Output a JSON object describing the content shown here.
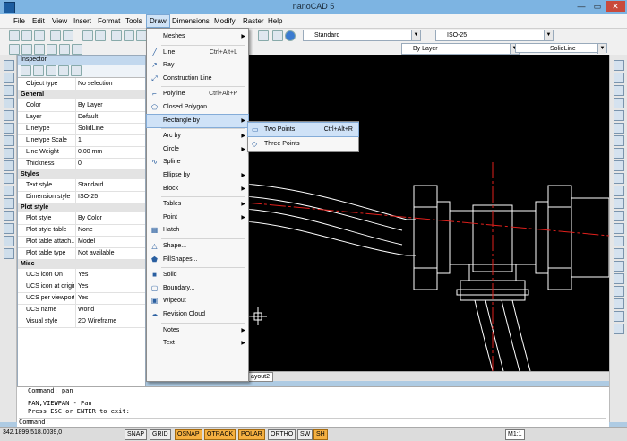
{
  "window": {
    "title": "nanoCAD 5"
  },
  "menubar": [
    "File",
    "Edit",
    "View",
    "Insert",
    "Format",
    "Tools",
    "Draw",
    "Dimensions",
    "Modify",
    "Raster",
    "Help"
  ],
  "toolbar": {
    "text_style": "Standard",
    "dim_style": "ISO-25",
    "layer": "By Layer",
    "linetype": "SolidLine"
  },
  "inspector": {
    "title": "Inspector",
    "object_type": {
      "name": "Object type",
      "value": "No selection"
    },
    "sections": [
      {
        "title": "General",
        "rows": [
          {
            "name": "Color",
            "value": "By Layer"
          },
          {
            "name": "Layer",
            "value": "Default"
          },
          {
            "name": "Linetype",
            "value": "SolidLine"
          },
          {
            "name": "Linetype Scale",
            "value": "1"
          },
          {
            "name": "Line Weight",
            "value": "0.00 mm"
          },
          {
            "name": "Thickness",
            "value": "0"
          }
        ]
      },
      {
        "title": "Styles",
        "rows": [
          {
            "name": "Text style",
            "value": "Standard"
          },
          {
            "name": "Dimension style",
            "value": "ISO-25"
          }
        ]
      },
      {
        "title": "Plot style",
        "rows": [
          {
            "name": "Plot style",
            "value": "By Color"
          },
          {
            "name": "Plot style table",
            "value": "None"
          },
          {
            "name": "Plot table attach...",
            "value": "Model"
          },
          {
            "name": "Plot table type",
            "value": "Not available"
          }
        ]
      },
      {
        "title": "Misc",
        "rows": [
          {
            "name": "UCS icon On",
            "value": "Yes"
          },
          {
            "name": "UCS icon at origin",
            "value": "Yes"
          },
          {
            "name": "UCS per viewport",
            "value": "Yes"
          },
          {
            "name": "UCS name",
            "value": "World"
          },
          {
            "name": "Visual style",
            "value": "2D Wireframe"
          }
        ]
      }
    ]
  },
  "draw_menu": {
    "items": [
      {
        "label": "Meshes",
        "shortcut": "",
        "submenu": true,
        "icon": ""
      },
      {
        "sep": true
      },
      {
        "label": "Line",
        "shortcut": "Ctrl+Alt+L",
        "submenu": false,
        "icon": "line-icon"
      },
      {
        "label": "Ray",
        "shortcut": "",
        "submenu": false,
        "icon": "ray-icon"
      },
      {
        "label": "Construction Line",
        "shortcut": "",
        "submenu": false,
        "icon": "construction-line-icon"
      },
      {
        "sep": true
      },
      {
        "label": "Polyline",
        "shortcut": "Ctrl+Alt+P",
        "submenu": false,
        "icon": "polyline-icon"
      },
      {
        "label": "Closed Polygon",
        "shortcut": "",
        "submenu": false,
        "icon": "polygon-icon"
      },
      {
        "label": "Rectangle by",
        "shortcut": "",
        "submenu": true,
        "icon": "",
        "highlighted": true
      },
      {
        "sep": true
      },
      {
        "label": "Arc by",
        "shortcut": "",
        "submenu": true,
        "icon": ""
      },
      {
        "label": "Circle",
        "shortcut": "",
        "submenu": true,
        "icon": ""
      },
      {
        "label": "Spline",
        "shortcut": "",
        "submenu": false,
        "icon": "spline-icon"
      },
      {
        "label": "Ellipse by",
        "shortcut": "",
        "submenu": true,
        "icon": ""
      },
      {
        "label": "Block",
        "shortcut": "",
        "submenu": true,
        "icon": ""
      },
      {
        "sep": true
      },
      {
        "label": "Tables",
        "shortcut": "",
        "submenu": true,
        "icon": ""
      },
      {
        "label": "Point",
        "shortcut": "",
        "submenu": true,
        "icon": ""
      },
      {
        "label": "Hatch",
        "shortcut": "",
        "submenu": false,
        "icon": "hatch-icon"
      },
      {
        "sep": true
      },
      {
        "label": "Shape...",
        "shortcut": "",
        "submenu": false,
        "icon": "shape-icon"
      },
      {
        "label": "FillShapes...",
        "shortcut": "",
        "submenu": false,
        "icon": "fillshapes-icon"
      },
      {
        "sep": true
      },
      {
        "label": "Solid",
        "shortcut": "",
        "submenu": false,
        "icon": "solid-icon"
      },
      {
        "label": "Boundary...",
        "shortcut": "",
        "submenu": false,
        "icon": "boundary-icon"
      },
      {
        "label": "Wipeout",
        "shortcut": "",
        "submenu": false,
        "icon": "wipeout-icon"
      },
      {
        "label": "Revision Cloud",
        "shortcut": "",
        "submenu": false,
        "icon": "revision-cloud-icon"
      },
      {
        "sep": true
      },
      {
        "label": "Notes",
        "shortcut": "",
        "submenu": true,
        "icon": ""
      },
      {
        "label": "Text",
        "shortcut": "",
        "submenu": true,
        "icon": ""
      }
    ]
  },
  "rectangle_submenu": [
    {
      "label": "Two Points",
      "shortcut": "Ctrl+Alt+R",
      "icon": "two-points-rect-icon"
    },
    {
      "label": "Three Points",
      "shortcut": "",
      "icon": "three-points-rect-icon"
    }
  ],
  "layout_tab": "ayout2",
  "command_lines": [
    "Command: pan",
    "PAN,VIEWPAN - Pan",
    "Press ESC or ENTER to exit:",
    "Command:"
  ],
  "status": {
    "coords": "342.1899,518.0039,0",
    "buttons": [
      {
        "label": "SNAP",
        "on": false
      },
      {
        "label": "GRID",
        "on": false
      },
      {
        "label": "OSNAP",
        "on": true
      },
      {
        "label": "OTRACK",
        "on": true
      },
      {
        "label": "POLAR",
        "on": true
      },
      {
        "label": "ORTHO",
        "on": false
      },
      {
        "label": "SW",
        "on": false
      },
      {
        "label": "SH",
        "on": true
      }
    ],
    "scale": "M1:1"
  },
  "colors": {
    "titlebar": "#7db4e2",
    "canvas": "#000000",
    "centerline": "#e0201c",
    "geometry": "#ffffff",
    "status_on": "#f5b041"
  }
}
